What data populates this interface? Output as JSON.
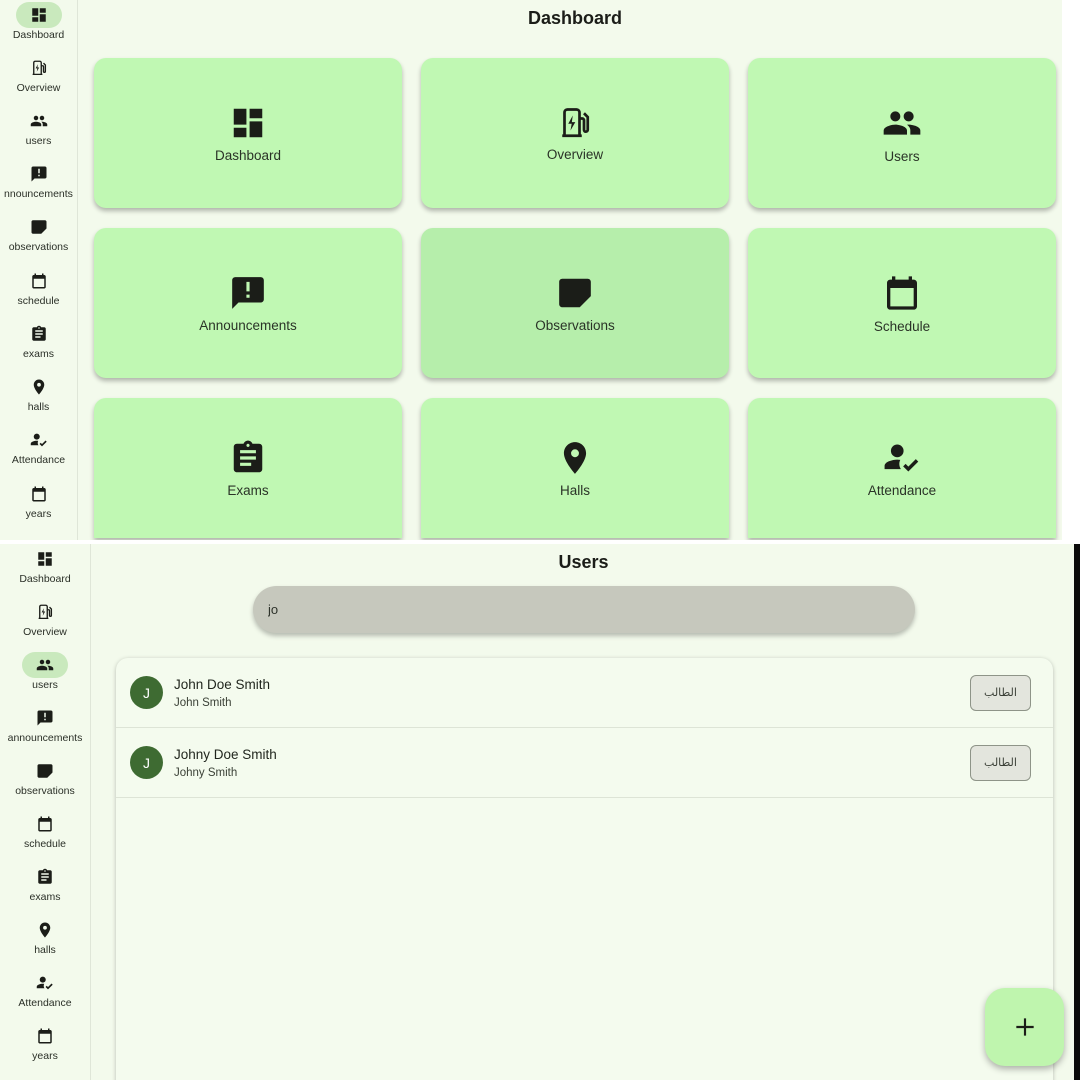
{
  "rail_labels": [
    "Dashboard",
    "Overview",
    "users",
    "announcements",
    "observations",
    "schedule",
    "exams",
    "halls",
    "Attendance",
    "years"
  ],
  "top": {
    "title": "Dashboard",
    "rail_labels": [
      "Dashboard",
      "Overview",
      "users",
      "nnouncements",
      "observations",
      "schedule",
      "exams",
      "halls",
      "Attendance",
      "years"
    ],
    "tiles": [
      {
        "label": "Dashboard",
        "icon": "dashboard-icon"
      },
      {
        "label": "Overview",
        "icon": "ev-station-icon"
      },
      {
        "label": "Users",
        "icon": "people-icon"
      },
      {
        "label": "Announcements",
        "icon": "announcement-icon"
      },
      {
        "label": "Observations",
        "icon": "sticky-note-icon"
      },
      {
        "label": "Schedule",
        "icon": "calendar-icon"
      },
      {
        "label": "Exams",
        "icon": "clipboard-icon"
      },
      {
        "label": "Halls",
        "icon": "location-pin-icon"
      },
      {
        "label": "Attendance",
        "icon": "person-check-icon"
      }
    ]
  },
  "bottom": {
    "title": "Users",
    "search": {
      "value": "jo"
    },
    "users": [
      {
        "initial": "J",
        "name": "John Doe Smith",
        "subtitle": "John Smith",
        "role": "الطالب"
      },
      {
        "initial": "J",
        "name": "Johny Doe Smith",
        "subtitle": "Johny Smith",
        "role": "الطالب"
      }
    ],
    "fab": {
      "icon": "plus-icon"
    }
  },
  "colors": {
    "tile": "#c0f8b3",
    "avatar": "#3e6b32",
    "fab": "#bff5ae",
    "active_pill": "#c9e9bd"
  }
}
